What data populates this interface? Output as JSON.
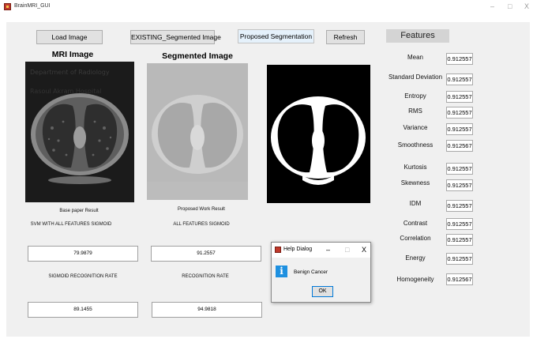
{
  "window": {
    "title": "BrainMRI_GUI",
    "minimize_glyph": "–",
    "maximize_glyph": "□",
    "close_glyph": "X"
  },
  "toolbar": {
    "load_image": "Load Image",
    "existing_segmented": "EXISTING_Segmented Image",
    "proposed_segmentation": "Proposed Segmentation",
    "refresh": "Refresh"
  },
  "panels": {
    "mri_title": "MRI Image",
    "segmented_title": "Segmented Image"
  },
  "left_results": {
    "base_label": "Base paper Result",
    "base_method": "SVM WITH ALL FEATURES SIGMOID",
    "base_value": "79.9879",
    "base_rate_label": "SIGMOID RECOGNITION RATE",
    "base_rate_value": "89.1455"
  },
  "right_results": {
    "proposed_label": "Proposed Work Result",
    "proposed_method": "ALL FEATURES SIGMOID",
    "proposed_value": "91.2557",
    "proposed_rate_label": "RECOGNITION RATE",
    "proposed_rate_value": "94.9818"
  },
  "features": {
    "header": "Features",
    "items": [
      {
        "label": "Mean",
        "value": "0.912557"
      },
      {
        "label": "Standard Deviation",
        "value": "0.912557"
      },
      {
        "label": "Entropy",
        "value": "0.912557"
      },
      {
        "label": "RMS",
        "value": "0.912557"
      },
      {
        "label": "Variance",
        "value": "0.912557"
      },
      {
        "label": "Smoothness",
        "value": "0.912567"
      },
      {
        "label": "Kurtosis",
        "value": "0.912557"
      },
      {
        "label": "Skewness",
        "value": "0.912557"
      },
      {
        "label": "IDM",
        "value": "0.912557"
      },
      {
        "label": "Contrast",
        "value": "0.912557"
      },
      {
        "label": "Correlation",
        "value": "0.912557"
      },
      {
        "label": "Energy",
        "value": "0.912557"
      },
      {
        "label": "Homogeneity",
        "value": "0.912567"
      }
    ]
  },
  "dialog": {
    "title": "Help Dialog",
    "message": "Benign Cancer",
    "ok": "OK",
    "minimize_glyph": "–",
    "maximize_glyph": "□",
    "close_glyph": "X",
    "info_glyph": "i"
  },
  "colors": {
    "window_bg": "#f0f0f0",
    "info_blue": "#1e90e0"
  }
}
